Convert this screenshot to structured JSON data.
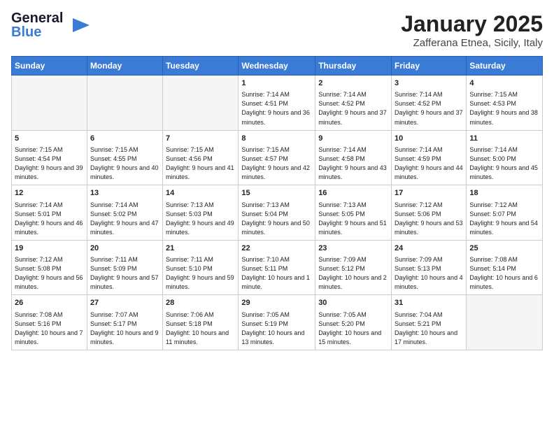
{
  "header": {
    "logo_general": "General",
    "logo_blue": "Blue",
    "month": "January 2025",
    "location": "Zafferana Etnea, Sicily, Italy"
  },
  "days_of_week": [
    "Sunday",
    "Monday",
    "Tuesday",
    "Wednesday",
    "Thursday",
    "Friday",
    "Saturday"
  ],
  "weeks": [
    [
      {
        "day": "",
        "empty": true
      },
      {
        "day": "",
        "empty": true
      },
      {
        "day": "",
        "empty": true
      },
      {
        "day": "1",
        "info": "Sunrise: 7:14 AM\nSunset: 4:51 PM\nDaylight: 9 hours and 36 minutes."
      },
      {
        "day": "2",
        "info": "Sunrise: 7:14 AM\nSunset: 4:52 PM\nDaylight: 9 hours and 37 minutes."
      },
      {
        "day": "3",
        "info": "Sunrise: 7:14 AM\nSunset: 4:52 PM\nDaylight: 9 hours and 37 minutes."
      },
      {
        "day": "4",
        "info": "Sunrise: 7:15 AM\nSunset: 4:53 PM\nDaylight: 9 hours and 38 minutes."
      }
    ],
    [
      {
        "day": "5",
        "info": "Sunrise: 7:15 AM\nSunset: 4:54 PM\nDaylight: 9 hours and 39 minutes."
      },
      {
        "day": "6",
        "info": "Sunrise: 7:15 AM\nSunset: 4:55 PM\nDaylight: 9 hours and 40 minutes."
      },
      {
        "day": "7",
        "info": "Sunrise: 7:15 AM\nSunset: 4:56 PM\nDaylight: 9 hours and 41 minutes."
      },
      {
        "day": "8",
        "info": "Sunrise: 7:15 AM\nSunset: 4:57 PM\nDaylight: 9 hours and 42 minutes."
      },
      {
        "day": "9",
        "info": "Sunrise: 7:14 AM\nSunset: 4:58 PM\nDaylight: 9 hours and 43 minutes."
      },
      {
        "day": "10",
        "info": "Sunrise: 7:14 AM\nSunset: 4:59 PM\nDaylight: 9 hours and 44 minutes."
      },
      {
        "day": "11",
        "info": "Sunrise: 7:14 AM\nSunset: 5:00 PM\nDaylight: 9 hours and 45 minutes."
      }
    ],
    [
      {
        "day": "12",
        "info": "Sunrise: 7:14 AM\nSunset: 5:01 PM\nDaylight: 9 hours and 46 minutes."
      },
      {
        "day": "13",
        "info": "Sunrise: 7:14 AM\nSunset: 5:02 PM\nDaylight: 9 hours and 47 minutes."
      },
      {
        "day": "14",
        "info": "Sunrise: 7:13 AM\nSunset: 5:03 PM\nDaylight: 9 hours and 49 minutes."
      },
      {
        "day": "15",
        "info": "Sunrise: 7:13 AM\nSunset: 5:04 PM\nDaylight: 9 hours and 50 minutes."
      },
      {
        "day": "16",
        "info": "Sunrise: 7:13 AM\nSunset: 5:05 PM\nDaylight: 9 hours and 51 minutes."
      },
      {
        "day": "17",
        "info": "Sunrise: 7:12 AM\nSunset: 5:06 PM\nDaylight: 9 hours and 53 minutes."
      },
      {
        "day": "18",
        "info": "Sunrise: 7:12 AM\nSunset: 5:07 PM\nDaylight: 9 hours and 54 minutes."
      }
    ],
    [
      {
        "day": "19",
        "info": "Sunrise: 7:12 AM\nSunset: 5:08 PM\nDaylight: 9 hours and 56 minutes."
      },
      {
        "day": "20",
        "info": "Sunrise: 7:11 AM\nSunset: 5:09 PM\nDaylight: 9 hours and 57 minutes."
      },
      {
        "day": "21",
        "info": "Sunrise: 7:11 AM\nSunset: 5:10 PM\nDaylight: 9 hours and 59 minutes."
      },
      {
        "day": "22",
        "info": "Sunrise: 7:10 AM\nSunset: 5:11 PM\nDaylight: 10 hours and 1 minute."
      },
      {
        "day": "23",
        "info": "Sunrise: 7:09 AM\nSunset: 5:12 PM\nDaylight: 10 hours and 2 minutes."
      },
      {
        "day": "24",
        "info": "Sunrise: 7:09 AM\nSunset: 5:13 PM\nDaylight: 10 hours and 4 minutes."
      },
      {
        "day": "25",
        "info": "Sunrise: 7:08 AM\nSunset: 5:14 PM\nDaylight: 10 hours and 6 minutes."
      }
    ],
    [
      {
        "day": "26",
        "info": "Sunrise: 7:08 AM\nSunset: 5:16 PM\nDaylight: 10 hours and 7 minutes."
      },
      {
        "day": "27",
        "info": "Sunrise: 7:07 AM\nSunset: 5:17 PM\nDaylight: 10 hours and 9 minutes."
      },
      {
        "day": "28",
        "info": "Sunrise: 7:06 AM\nSunset: 5:18 PM\nDaylight: 10 hours and 11 minutes."
      },
      {
        "day": "29",
        "info": "Sunrise: 7:05 AM\nSunset: 5:19 PM\nDaylight: 10 hours and 13 minutes."
      },
      {
        "day": "30",
        "info": "Sunrise: 7:05 AM\nSunset: 5:20 PM\nDaylight: 10 hours and 15 minutes."
      },
      {
        "day": "31",
        "info": "Sunrise: 7:04 AM\nSunset: 5:21 PM\nDaylight: 10 hours and 17 minutes."
      },
      {
        "day": "",
        "empty": true
      }
    ]
  ]
}
